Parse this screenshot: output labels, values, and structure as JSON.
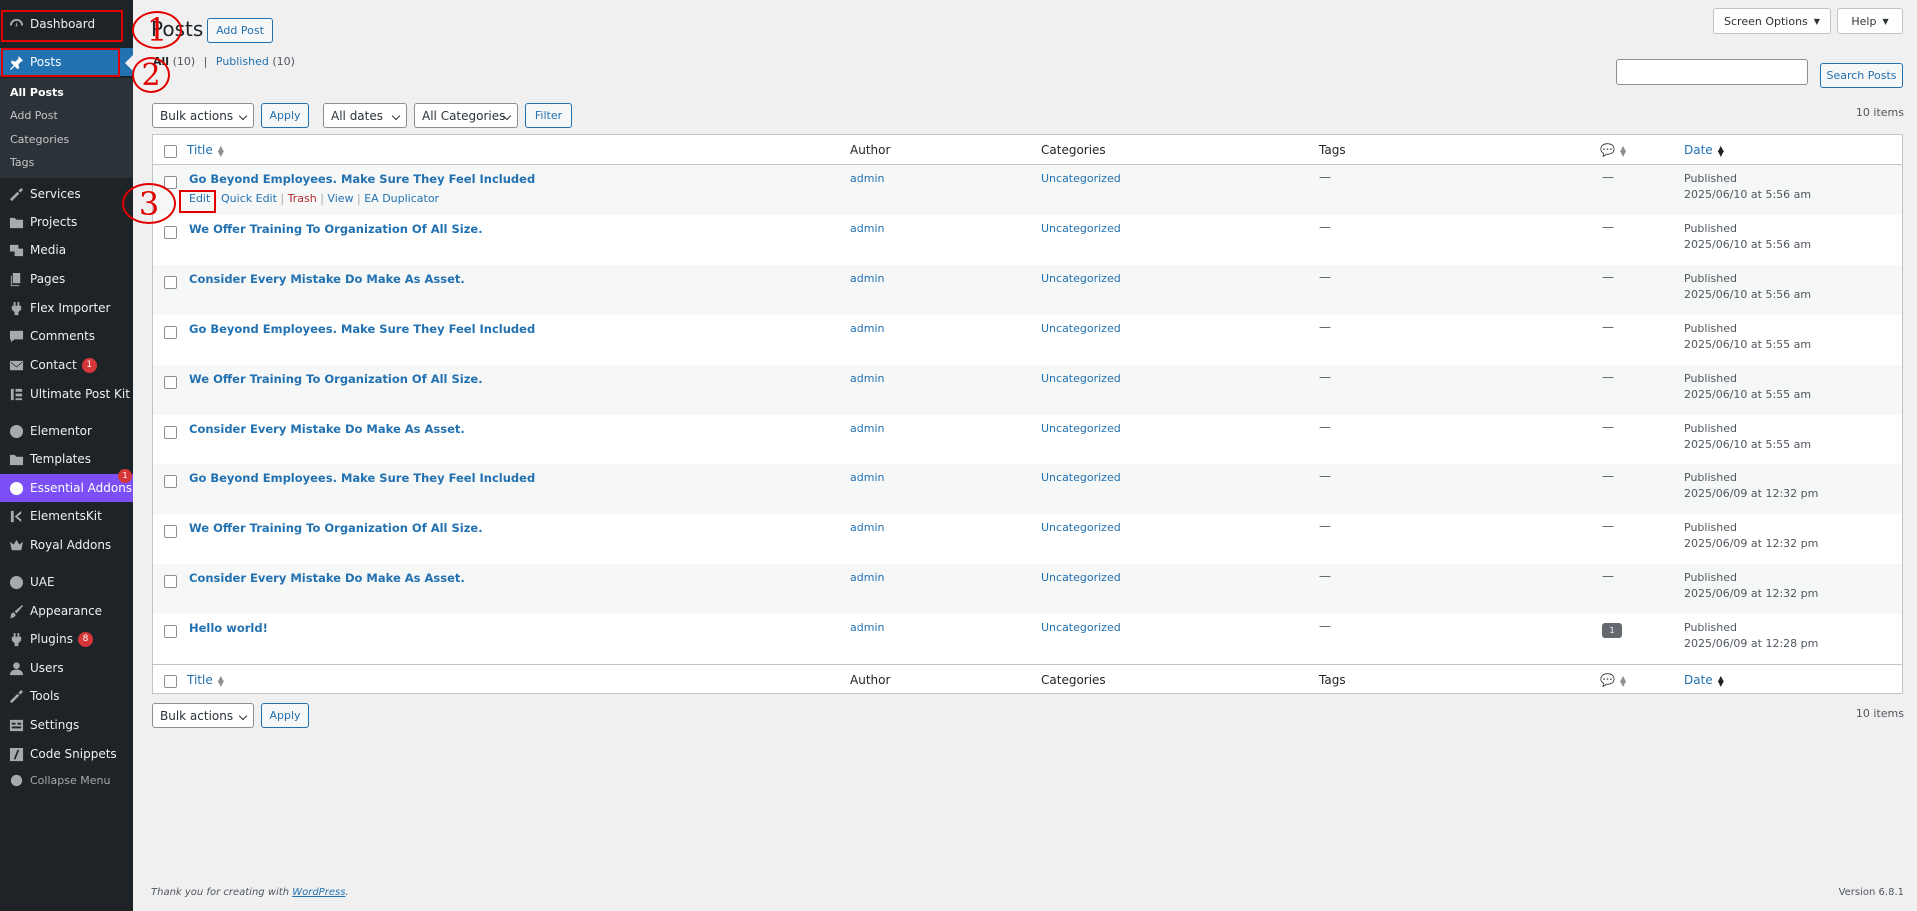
{
  "sidebar": {
    "items": [
      {
        "key": "dashboard",
        "label": "Dashboard",
        "icon": "dashboard-icon"
      },
      {
        "key": "posts",
        "label": "Posts",
        "icon": "pin-icon"
      },
      {
        "key": "services",
        "label": "Services",
        "icon": "wrench-icon"
      },
      {
        "key": "projects",
        "label": "Projects",
        "icon": "folder-icon"
      },
      {
        "key": "media",
        "label": "Media",
        "icon": "media-icon"
      },
      {
        "key": "pages",
        "label": "Pages",
        "icon": "pages-icon"
      },
      {
        "key": "flex-importer",
        "label": "Flex Importer",
        "icon": "plug-icon"
      },
      {
        "key": "comments",
        "label": "Comments",
        "icon": "comment-icon"
      },
      {
        "key": "contact",
        "label": "Contact",
        "icon": "mail-icon",
        "badge": "1"
      },
      {
        "key": "ultimate-post-kit",
        "label": "Ultimate Post Kit",
        "icon": "upk-icon"
      },
      {
        "key": "elementor",
        "label": "Elementor",
        "icon": "elementor-icon"
      },
      {
        "key": "templates",
        "label": "Templates",
        "icon": "folder-icon"
      },
      {
        "key": "essential-addons",
        "label": "Essential Addons",
        "icon": "ea-icon",
        "badge": "1"
      },
      {
        "key": "elementskit",
        "label": "ElementsKit",
        "icon": "ek-icon"
      },
      {
        "key": "royal-addons",
        "label": "Royal Addons",
        "icon": "crown-icon"
      },
      {
        "key": "uae",
        "label": "UAE",
        "icon": "uae-icon"
      },
      {
        "key": "appearance",
        "label": "Appearance",
        "icon": "brush-icon"
      },
      {
        "key": "plugins",
        "label": "Plugins",
        "icon": "plugin-icon",
        "badge": "8"
      },
      {
        "key": "users",
        "label": "Users",
        "icon": "user-icon"
      },
      {
        "key": "tools",
        "label": "Tools",
        "icon": "wrench-icon"
      },
      {
        "key": "settings",
        "label": "Settings",
        "icon": "settings-icon"
      },
      {
        "key": "code-snippets",
        "label": "Code Snippets",
        "icon": "code-icon"
      },
      {
        "key": "collapse",
        "label": "Collapse Menu",
        "icon": "collapse-icon"
      }
    ],
    "submenu": [
      "All Posts",
      "Add Post",
      "Categories",
      "Tags"
    ]
  },
  "header": {
    "title": "Posts",
    "add_post": "Add Post",
    "screen_options": "Screen Options",
    "help": "Help"
  },
  "filters_links": {
    "all": "All",
    "all_count": "(10)",
    "sep": "|",
    "published": "Published",
    "published_count": "(10)"
  },
  "search": {
    "button": "Search Posts"
  },
  "toolbar": {
    "bulk_actions": "Bulk actions",
    "apply": "Apply",
    "all_dates": "All dates",
    "all_categories": "All Categories",
    "filter": "Filter",
    "items_count": "10 items"
  },
  "table": {
    "headers": {
      "title": "Title",
      "author": "Author",
      "categories": "Categories",
      "tags": "Tags",
      "date": "Date"
    },
    "row_actions": {
      "edit": "Edit",
      "quick_edit": "Quick Edit",
      "trash": "Trash",
      "view": "View",
      "ea_duplicator": "EA Duplicator"
    },
    "rows": [
      {
        "title": "Go Beyond Employees. Make Sure They Feel Included",
        "author": "admin",
        "category": "Uncategorized",
        "tags": "—",
        "comments": "—",
        "status": "Published",
        "date": "2025/06/10 at 5:56 am"
      },
      {
        "title": "We Offer Training To Organization Of All Size.",
        "author": "admin",
        "category": "Uncategorized",
        "tags": "—",
        "comments": "—",
        "status": "Published",
        "date": "2025/06/10 at 5:56 am"
      },
      {
        "title": "Consider Every Mistake Do Make As Asset.",
        "author": "admin",
        "category": "Uncategorized",
        "tags": "—",
        "comments": "—",
        "status": "Published",
        "date": "2025/06/10 at 5:56 am"
      },
      {
        "title": "Go Beyond Employees. Make Sure They Feel Included",
        "author": "admin",
        "category": "Uncategorized",
        "tags": "—",
        "comments": "—",
        "status": "Published",
        "date": "2025/06/10 at 5:55 am"
      },
      {
        "title": "We Offer Training To Organization Of All Size.",
        "author": "admin",
        "category": "Uncategorized",
        "tags": "—",
        "comments": "—",
        "status": "Published",
        "date": "2025/06/10 at 5:55 am"
      },
      {
        "title": "Consider Every Mistake Do Make As Asset.",
        "author": "admin",
        "category": "Uncategorized",
        "tags": "—",
        "comments": "—",
        "status": "Published",
        "date": "2025/06/10 at 5:55 am"
      },
      {
        "title": "Go Beyond Employees. Make Sure They Feel Included",
        "author": "admin",
        "category": "Uncategorized",
        "tags": "—",
        "comments": "—",
        "status": "Published",
        "date": "2025/06/09 at 12:32 pm"
      },
      {
        "title": "We Offer Training To Organization Of All Size.",
        "author": "admin",
        "category": "Uncategorized",
        "tags": "—",
        "comments": "—",
        "status": "Published",
        "date": "2025/06/09 at 12:32 pm"
      },
      {
        "title": "Consider Every Mistake Do Make As Asset.",
        "author": "admin",
        "category": "Uncategorized",
        "tags": "—",
        "comments": "—",
        "status": "Published",
        "date": "2025/06/09 at 12:32 pm"
      },
      {
        "title": "Hello world!",
        "author": "admin",
        "category": "Uncategorized",
        "tags": "—",
        "comments": "1",
        "status": "Published",
        "date": "2025/06/09 at 12:28 pm"
      }
    ]
  },
  "annotations": [
    "1",
    "2",
    "3"
  ],
  "footer": {
    "thanks_prefix": "Thank you for creating with ",
    "wordpress": "WordPress",
    "thanks_suffix": ".",
    "version": "Version 6.8.1"
  }
}
